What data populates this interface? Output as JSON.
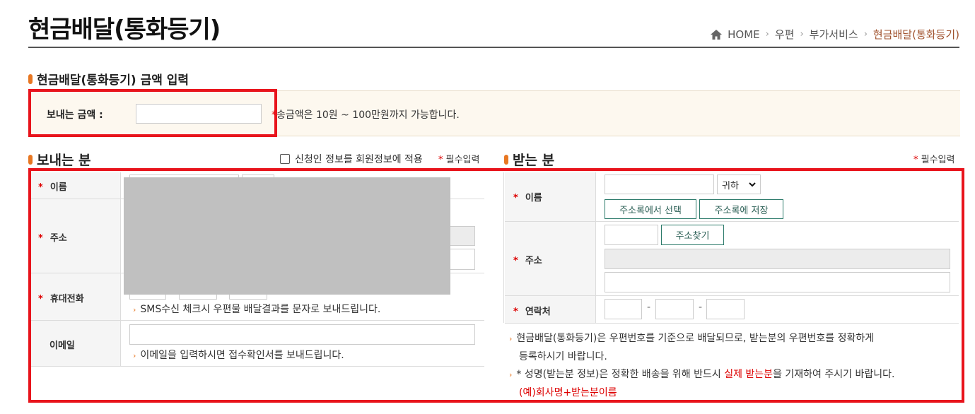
{
  "header": {
    "title": "현금배달(통화등기)",
    "breadcrumb": {
      "home": "HOME",
      "items": [
        "우편",
        "부가서비스"
      ],
      "current": "현금배달(통화등기)"
    }
  },
  "amount": {
    "section_title": "현금배달(통화등기) 금액 입력",
    "label": "보내는 금액 :",
    "value": "",
    "note_star": "*",
    "note": "송금액은 10원 ~ 100만원까지 가능합니다."
  },
  "sender": {
    "section_title": "보내는 분",
    "apply_member_label": "신청인 정보를 회원정보에 적용",
    "required_star": "*",
    "required_label": "필수입력",
    "star": "*",
    "name_label": "이름",
    "address_label": "주소",
    "phone_label": "휴대전화",
    "email_label": "이메일",
    "sms_note": "SMS수신 체크시 우편물 배달결과를 문자로 보내드립니다.",
    "email_note": "이메일을 입력하시면 접수확인서를 보내드립니다."
  },
  "receiver": {
    "section_title": "받는 분",
    "required_star": "*",
    "required_label": "필수입력",
    "star": "*",
    "name_label": "이름",
    "honorific": "귀하",
    "addressbook_select": "주소록에서 선택",
    "addressbook_save": "주소록에 저장",
    "address_label": "주소",
    "find_address": "주소찾기",
    "contact_label": "연락처",
    "dash": "-",
    "note1_line1": "현금배달(통화등기)은 우편번호를 기준으로 배달되므로, 받는분의 우편번호를 정확하게",
    "note1_line2": "등록하시기 바랍니다.",
    "note2_prefix": "* 성명(받는분 정보)은 정확한 배송을 위해 반드시 ",
    "note2_red": "실제 받는분",
    "note2_suffix": "을 기재하여 주시기 바랍니다.",
    "note2_example": "(예)회사명+받는분이름"
  },
  "colors": {
    "accent": "#e87722",
    "highlight_frame": "#e8141c",
    "required": "#dd0000",
    "button_border": "#2b7a6a"
  }
}
